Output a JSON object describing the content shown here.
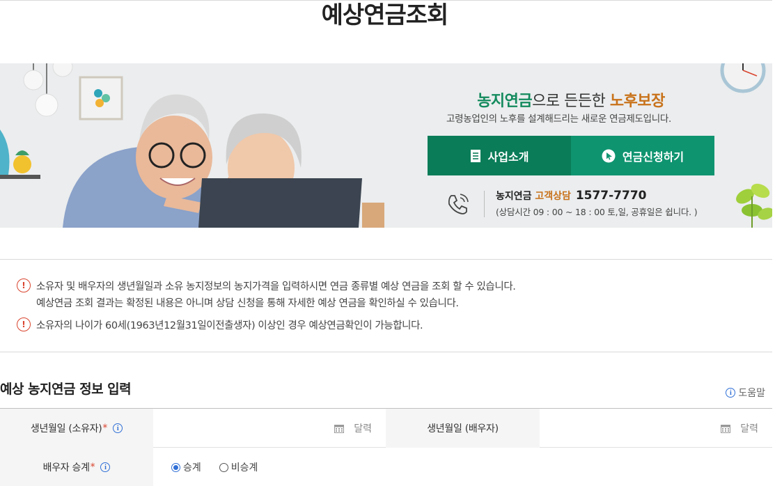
{
  "page": {
    "title": "예상연금조회"
  },
  "banner": {
    "slogan_green": "농지연금",
    "slogan_mid": "으로 든든한 ",
    "slogan_orange": "노후보장",
    "subslogan": "고령농업인의 노후를 설계해드리는 새로운 연금제도입니다.",
    "btn_intro": "사업소개",
    "btn_apply": "연금신청하기",
    "contact_label": "농지연금",
    "contact_cs": "고객상담",
    "contact_number": "1577-7770",
    "contact_hours": "(상담시간 09 : 00 ~ 18 : 00 토,일, 공휴일은 쉽니다. )"
  },
  "notices": [
    {
      "line1": "소유자 및 배우자의 생년월일과 소유 농지정보의 농지가격을 입력하시면 연금 종류별 예상 연금을 조회 할 수 있습니다.",
      "line2": "예상연금 조회 결과는 확정된 내용은 아니며 상담 신청을 통해 자세한 예상 연금을 확인하실 수 있습니다."
    },
    {
      "line1": "소유자의 나이가 60세(1963년12월31일이전출생자) 이상인 경우 예상연금확인이 가능합니다."
    }
  ],
  "form": {
    "section_title": "예상 농지연금 정보 입력",
    "help": "도움말",
    "owner_birth_label": "생년월일 (소유자)",
    "spouse_birth_label": "생년월일 (배우자)",
    "calendar_label": "달력",
    "succession_label": "배우자 승계",
    "required_mark": "*",
    "info_glyph": "i",
    "radio_options": [
      "승계",
      "비승계"
    ],
    "radio_selected": "승계"
  },
  "colors": {
    "green_dark": "#0a7c58",
    "green": "#0f9470",
    "orange": "#c8721a",
    "warn_red": "#d9442e",
    "info_blue": "#2f6fd6"
  }
}
